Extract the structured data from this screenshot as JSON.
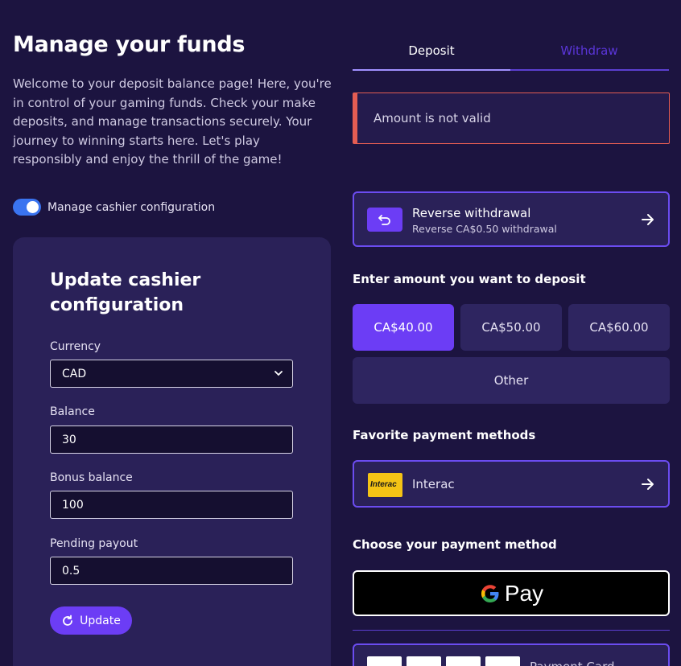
{
  "page": {
    "title": "Manage your funds",
    "intro": "Welcome to your deposit balance page! Here, you're in control of your gaming funds. Check your make deposits, and manage transactions securely. Your journey to winning starts here. Let's play responsibly and enjoy the thrill of the game!"
  },
  "toggle": {
    "label": "Manage cashier configuration",
    "on": true
  },
  "config": {
    "title": "Update cashier configuration",
    "currency_label": "Currency",
    "currency_value": "CAD",
    "balance_label": "Balance",
    "balance_value": "30",
    "bonus_label": "Bonus balance",
    "bonus_value": "100",
    "pending_label": "Pending payout",
    "pending_value": "0.5",
    "update_label": "Update"
  },
  "tabs": {
    "deposit": "Deposit",
    "withdraw": "Withdraw",
    "active": "Deposit"
  },
  "alert": {
    "message": "Amount is not valid"
  },
  "reverse": {
    "title": "Reverse withdrawal",
    "subtitle": "Reverse CA$0.50 withdrawal"
  },
  "amounts": {
    "heading": "Enter amount you want to deposit",
    "options": [
      "CA$40.00",
      "CA$50.00",
      "CA$60.00"
    ],
    "selected": "CA$40.00",
    "other": "Other"
  },
  "favorites": {
    "heading": "Favorite payment methods",
    "items": [
      {
        "label": "Interac",
        "logo_text": "Interac"
      }
    ]
  },
  "methods": {
    "heading": "Choose your payment method",
    "gpay_label": "Pay",
    "card_label": "Payment Card"
  },
  "colors": {
    "background": "#1c1440",
    "accent": "#6c3df5",
    "error": "#e45d53",
    "toggle": "#3a74f0"
  }
}
